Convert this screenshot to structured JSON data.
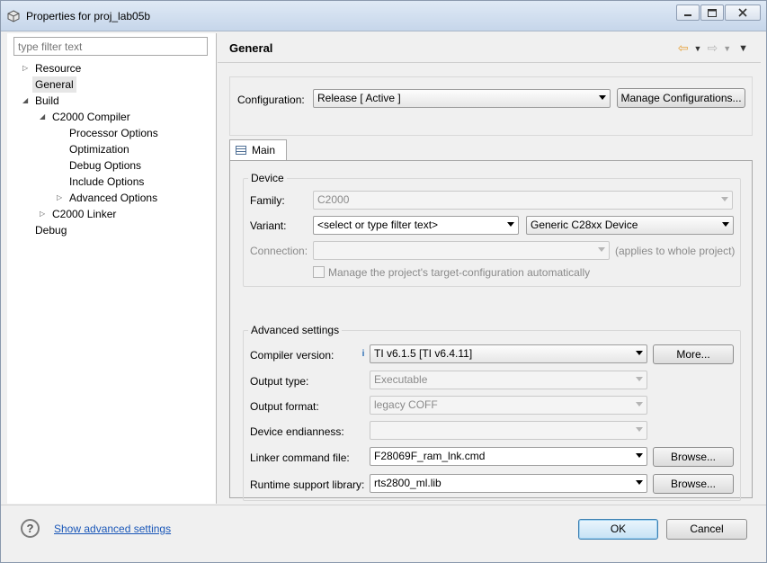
{
  "window": {
    "title": "Properties for proj_lab05b",
    "controls": [
      "minimize",
      "maximize",
      "close"
    ]
  },
  "left": {
    "filter_placeholder": "type filter text",
    "tree": [
      {
        "label": "Resource",
        "level": 0,
        "expander": "collapsed"
      },
      {
        "label": "General",
        "level": 0,
        "expander": "none",
        "selected": true
      },
      {
        "label": "Build",
        "level": 0,
        "expander": "expanded"
      },
      {
        "label": "C2000 Compiler",
        "level": 1,
        "expander": "expanded"
      },
      {
        "label": "Processor Options",
        "level": 2,
        "expander": "none"
      },
      {
        "label": "Optimization",
        "level": 2,
        "expander": "none"
      },
      {
        "label": "Debug Options",
        "level": 2,
        "expander": "none"
      },
      {
        "label": "Include Options",
        "level": 2,
        "expander": "none"
      },
      {
        "label": "Advanced Options",
        "level": 2,
        "expander": "collapsed"
      },
      {
        "label": "C2000 Linker",
        "level": 1,
        "expander": "collapsed"
      },
      {
        "label": "Debug",
        "level": 0,
        "expander": "none"
      }
    ]
  },
  "main": {
    "title": "General",
    "configuration": {
      "label": "Configuration:",
      "value": "Release  [ Active ]",
      "manage_button": "Manage Configurations..."
    },
    "tab": {
      "label": "Main"
    },
    "device": {
      "group_title": "Device",
      "family_label": "Family:",
      "family_value": "C2000",
      "variant_label": "Variant:",
      "variant_filter": "<select or type filter text>",
      "variant_value": "Generic C28xx Device",
      "connection_label": "Connection:",
      "connection_note": "(applies to whole project)",
      "manage_target_label": "Manage the project's target-configuration automatically"
    },
    "advanced": {
      "group_title": "Advanced settings",
      "compiler_version_label": "Compiler version:",
      "compiler_version_value": "TI v6.1.5  [TI v6.4.11]",
      "more_button": "More...",
      "output_type_label": "Output type:",
      "output_type_value": "Executable",
      "output_format_label": "Output format:",
      "output_format_value": "legacy COFF",
      "endianness_label": "Device endianness:",
      "endianness_value": "",
      "linker_cmd_label": "Linker command file:",
      "linker_cmd_value": "F28069F_ram_lnk.cmd",
      "browse_button": "Browse...",
      "rts_label": "Runtime support library:",
      "rts_value": "rts2800_ml.lib"
    }
  },
  "footer": {
    "help_glyph": "?",
    "advanced_link": "Show advanced settings",
    "ok_button": "OK",
    "cancel_button": "Cancel"
  }
}
